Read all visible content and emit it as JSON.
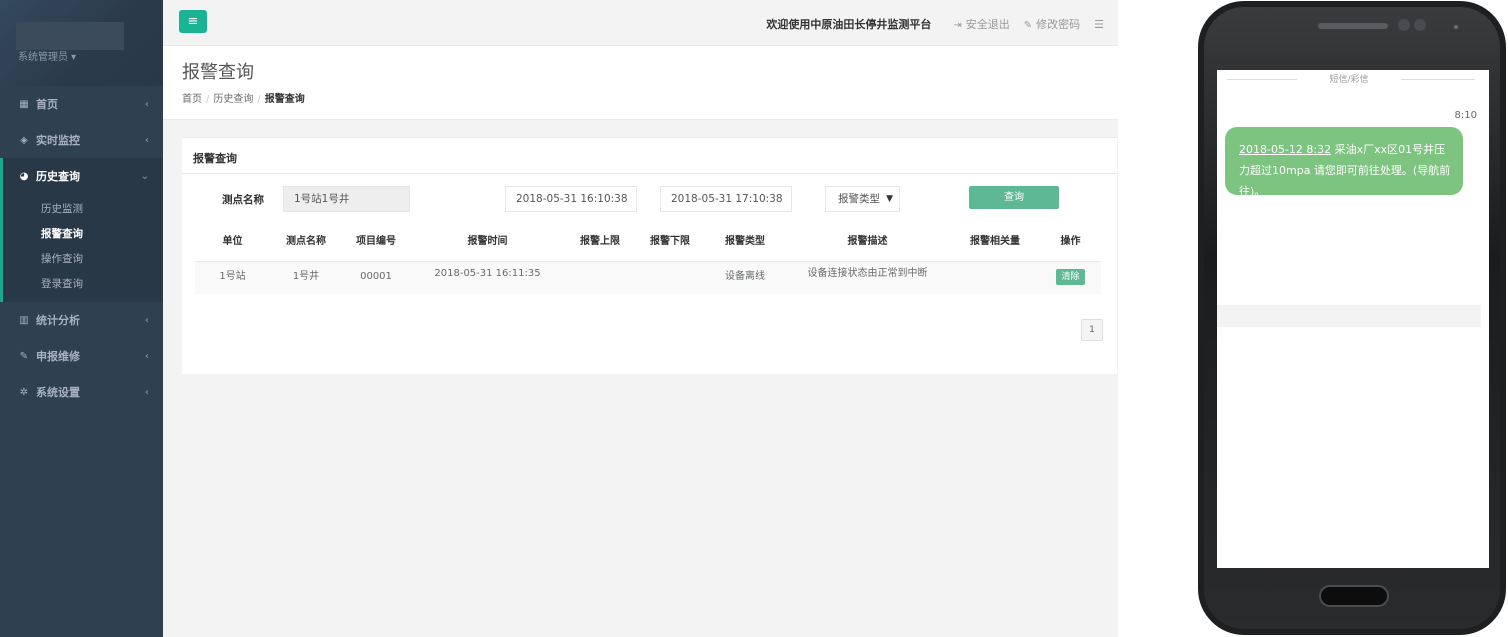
{
  "sidebar": {
    "user": "系统管理员 ▾",
    "items": [
      {
        "icon": "grid-icon",
        "glyph": "▦",
        "label": "首页"
      },
      {
        "icon": "diamond-icon",
        "glyph": "◈",
        "label": "实时监控"
      },
      {
        "icon": "pie-chart-icon",
        "glyph": "◕",
        "label": "历史查询"
      },
      {
        "icon": "bar-chart-icon",
        "glyph": "▥",
        "label": "统计分析"
      },
      {
        "icon": "edit-icon",
        "glyph": "✎",
        "label": "申报维修"
      },
      {
        "icon": "gear-icon",
        "glyph": "✲",
        "label": "系统设置"
      }
    ],
    "submenu": [
      "历史监测",
      "报警查询",
      "操作查询",
      "登录查询"
    ],
    "arrow_collapsed": "‹",
    "arrow_expanded": "⌄"
  },
  "topbar": {
    "menu_glyph": "≡",
    "welcome": "欢迎使用中原油田长停井监测平台",
    "logout": "安全退出",
    "change_password": "修改密码",
    "logout_glyph": "⇥",
    "password_glyph": "✎",
    "list_glyph": "☰"
  },
  "page": {
    "title": "报警查询",
    "breadcrumb": [
      "首页",
      "历史查询",
      "报警查询"
    ],
    "breadcrumb_sep": "/"
  },
  "panel": {
    "title": "报警查询",
    "point_label": "测点名称",
    "point_value": "1号站1号井",
    "start_time": "2018-05-31 16:10:38",
    "end_time": "2018-05-31 17:10:38",
    "alarm_type": "报警类型",
    "caret": "▼",
    "query_button": "查询"
  },
  "table": {
    "headers": [
      "单位",
      "测点名称",
      "项目编号",
      "报警时间",
      "报警上限",
      "报警下限",
      "报警类型",
      "报警描述",
      "报警相关量",
      "操作"
    ],
    "rows": [
      {
        "unit": "1号站",
        "point": "1号井",
        "project": "00001",
        "time": "2018-05-31 16:11:35",
        "upper": "",
        "lower": "",
        "type": "设备离线",
        "desc": "设备连接状态由正常到中断",
        "related": "",
        "action": "清除"
      }
    ]
  },
  "pagination": {
    "page": "1"
  },
  "phone": {
    "header": "短信/彩信",
    "time": "8:10",
    "message_date": "2018-05-12 8:32",
    "message_body": " 采油x厂xx区01号井压力超过10mpa 请您即可前往处理。(导航前往)。"
  },
  "colors": {
    "sidebar_bg": "#2f4050",
    "accent": "#1ab394",
    "button_green": "#5fb894",
    "bubble_green": "#7cc47f"
  }
}
